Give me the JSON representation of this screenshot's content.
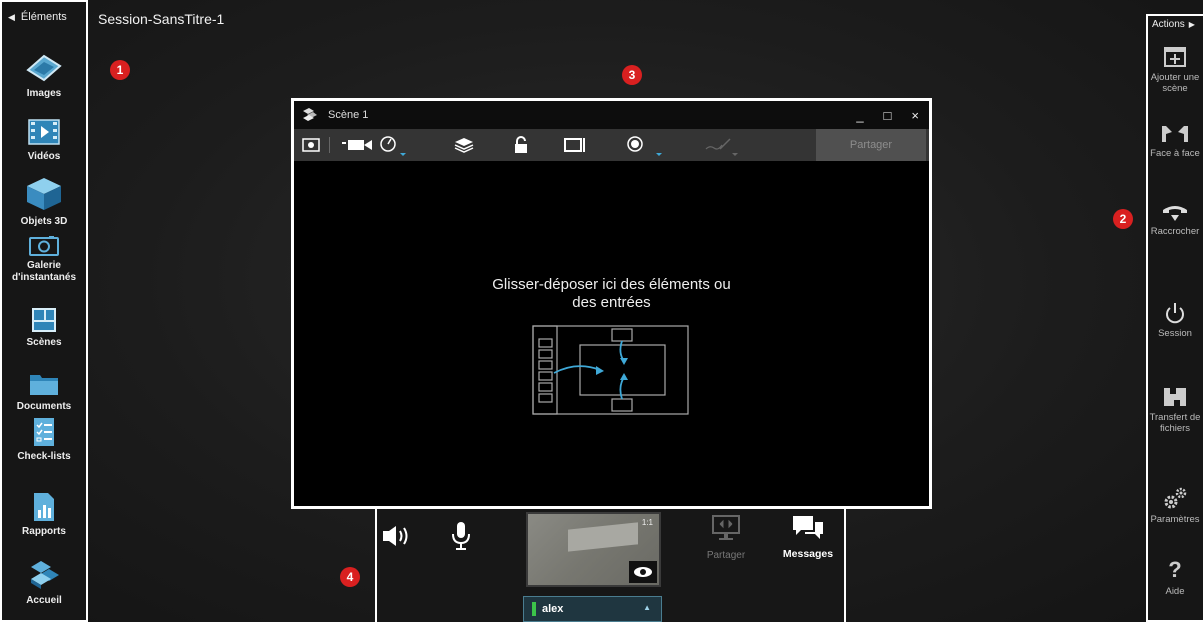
{
  "session": {
    "title": "Session-SansTitre-1"
  },
  "left_sidebar": {
    "header": "Éléments",
    "items": [
      {
        "label": "Images",
        "icon": "images-icon"
      },
      {
        "label": "Vidéos",
        "icon": "videos-icon"
      },
      {
        "label": "Objets 3D",
        "icon": "cube-icon"
      },
      {
        "label": "Galerie d'instantanés",
        "icon": "camera-icon"
      },
      {
        "label": "Scènes",
        "icon": "scenes-icon"
      },
      {
        "label": "Documents",
        "icon": "folder-icon"
      },
      {
        "label": "Check-lists",
        "icon": "checklist-icon"
      },
      {
        "label": "Rapports",
        "icon": "report-icon"
      },
      {
        "label": "Accueil",
        "icon": "home-icon"
      }
    ]
  },
  "right_sidebar": {
    "header": "Actions",
    "items": [
      {
        "label": "Ajouter une scène",
        "icon": "add-scene-icon"
      },
      {
        "label": "Face à face",
        "icon": "face-to-face-icon"
      },
      {
        "label": "Raccrocher",
        "icon": "hang-up-icon"
      },
      {
        "label": "Session",
        "icon": "power-icon"
      },
      {
        "label": "Transfert de fichiers",
        "icon": "file-transfer-icon"
      },
      {
        "label": "Paramètres",
        "icon": "gears-icon"
      },
      {
        "label": "Aide",
        "icon": "help-icon"
      }
    ]
  },
  "badges": [
    "1",
    "2",
    "3",
    "4"
  ],
  "scene": {
    "title": "Scène 1",
    "share_label": "Partager",
    "drop_text_line1": "Glisser-déposer ici des éléments ou",
    "drop_text_line2": "des entrées",
    "window_controls": [
      "_",
      "□",
      "×"
    ]
  },
  "bottom_panel": {
    "share_label": "Partager",
    "messages_label": "Messages",
    "user_name": "alex",
    "video_overlay": "1:1"
  },
  "colors": {
    "accent": "#3fa9d8",
    "badge": "#d92020",
    "online": "#3cc44a"
  }
}
